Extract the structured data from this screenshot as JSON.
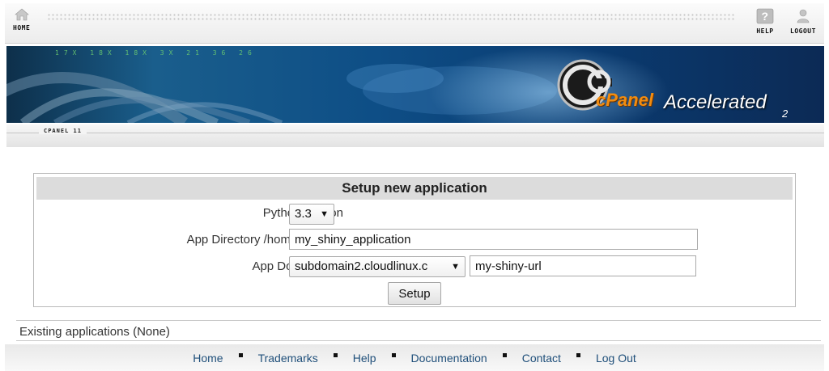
{
  "nav": {
    "home_label": "HOME",
    "help_label": "HELP",
    "logout_label": "LOGOUT"
  },
  "banner": {
    "digits": "17X 18X 18X 3X 21 36 26",
    "logo_c": "cPanel",
    "logo_accelerated": "Accelerated",
    "logo_version": "2"
  },
  "section": {
    "label": "CPANEL 11"
  },
  "setup": {
    "title": "Setup new application",
    "python_label": "Python version",
    "python_value": "3.3",
    "app_dir_label": "App Directory /home/clman1/",
    "app_dir_value": "my_shiny_application",
    "domain_label": "App Domain/URI",
    "domain_value": "subdomain2.cloudlinux.c",
    "uri_value": "my-shiny-url",
    "setup_button": "Setup"
  },
  "existing": {
    "text": "Existing applications (None)"
  },
  "footer": {
    "links": [
      "Home",
      "Trademarks",
      "Help",
      "Documentation",
      "Contact",
      "Log Out"
    ]
  },
  "colors": {
    "link": "#1f4f7a",
    "panel_header": "#dcdcdc",
    "logo_orange": "#f28c10"
  }
}
